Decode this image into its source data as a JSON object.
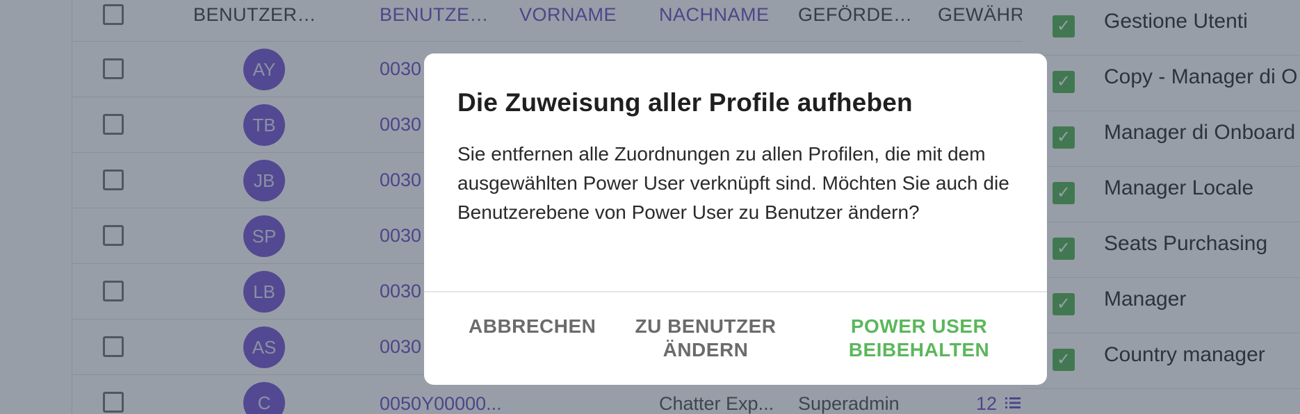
{
  "table": {
    "headers": [
      "BENUTZERBILD",
      "BENUTZER...",
      "VORNAME",
      "NACHNAME",
      "GEFÖRDERT...",
      "GEWÄHR"
    ],
    "rows": [
      {
        "initials": "AY",
        "user_id": "0030"
      },
      {
        "initials": "TB",
        "user_id": "0030"
      },
      {
        "initials": "JB",
        "user_id": "0030"
      },
      {
        "initials": "SP",
        "user_id": "0030"
      },
      {
        "initials": "LB",
        "user_id": "0030"
      },
      {
        "initials": "AS",
        "user_id": "0030"
      },
      {
        "initials": "C",
        "user_id": "0050Y00000...",
        "last_name": "Chatter Exp...",
        "promoted": "Superadmin",
        "count": "12"
      }
    ]
  },
  "profiles_panel": {
    "items": [
      {
        "label": "Gestione Utenti"
      },
      {
        "label": "Copy - Manager di O"
      },
      {
        "label": "Manager di Onboard"
      },
      {
        "label": "Manager Locale"
      },
      {
        "label": "Seats Purchasing"
      },
      {
        "label": "Manager"
      },
      {
        "label": "Country manager"
      }
    ]
  },
  "dialog": {
    "title": "Die Zuweisung aller Profile aufheben",
    "message": "Sie entfernen alle Zuordnungen zu allen Profilen, die mit dem ausgewählten Power User verknüpft sind. Möchten Sie auch die Benutzerebene von Power User zu Benutzer ändern?",
    "cancel_label": "ABBRECHEN",
    "change_line1": "ZU BENUTZER",
    "change_line2": "ÄNDERN",
    "keep_line1": "POWER USER",
    "keep_line2": "BEIBEHALTEN"
  },
  "colors": {
    "accent_purple": "#6b56c9",
    "avatar_purple": "#7a5cd6",
    "confirm_green": "#5bb75b",
    "overlay": "rgba(40,52,72,0.48)"
  },
  "icons": {
    "list": "list-icon",
    "check": "check-icon"
  }
}
